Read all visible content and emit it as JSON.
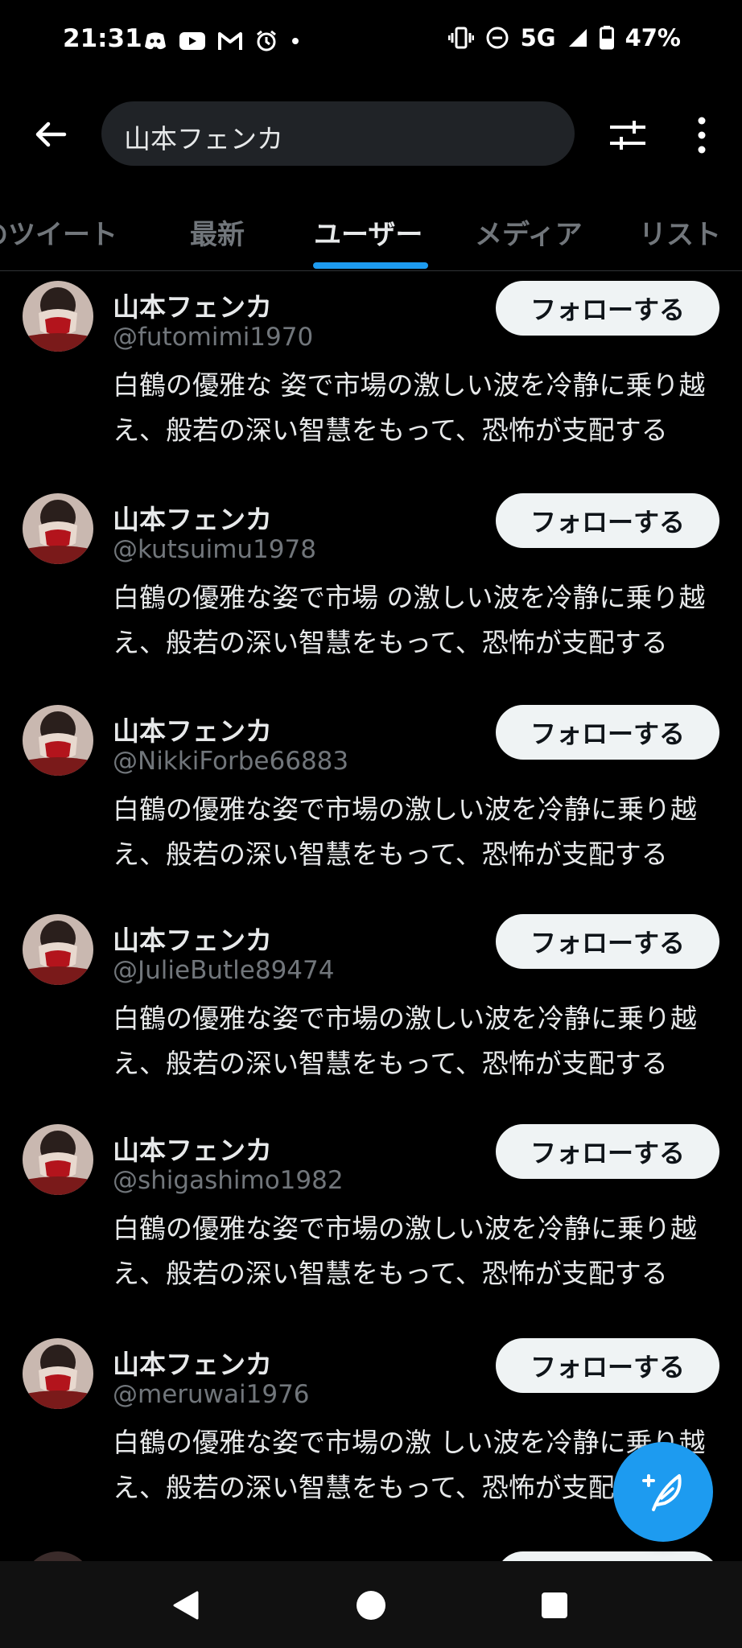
{
  "status_bar": {
    "time": "21:31",
    "network": "5G",
    "battery": "47%",
    "icons_left": [
      "discord-icon",
      "youtube-icon",
      "gmail-icon",
      "alarm-icon",
      "dot-icon"
    ],
    "icons_right": [
      "vibrate-icon",
      "do-not-disturb-icon",
      "signal-icon",
      "battery-icon"
    ]
  },
  "header": {
    "search_query": "山本フェンカ",
    "icons": [
      "back-arrow-icon",
      "filter-sliders-icon",
      "more-vertical-icon"
    ]
  },
  "tabs": [
    {
      "label": "のツイート",
      "active": false
    },
    {
      "label": "最新",
      "active": false
    },
    {
      "label": "ユーザー",
      "active": true
    },
    {
      "label": "メディア",
      "active": false
    },
    {
      "label": "リスト",
      "active": false
    }
  ],
  "users": [
    {
      "name": "山本フェンカ",
      "handle": "@futomimi1970",
      "bio": "白鶴の優雅な 姿で市場の激しい波を冷静に乗り越え、般若の深い智慧をもって、恐怖が支配する",
      "follow_label": "フォローする"
    },
    {
      "name": "山本フェンカ",
      "handle": "@kutsuimu1978",
      "bio": "白鶴の優雅な姿で市場 の激しい波を冷静に乗り越え、般若の深い智慧をもって、恐怖が支配する",
      "follow_label": "フォローする"
    },
    {
      "name": "山本フェンカ",
      "handle": "@NikkiForbe66883",
      "bio": "白鶴の優雅な姿で市場の激しい波を冷静に乗り越え、般若の深い智慧をもって、恐怖が支配する",
      "follow_label": "フォローする"
    },
    {
      "name": "山本フェンカ",
      "handle": "@JulieButle89474",
      "bio": "白鶴の優雅な姿で市場の激しい波を冷静に乗り越え、般若の深い智慧をもって、恐怖が支配する",
      "follow_label": "フォローする"
    },
    {
      "name": "山本フェンカ",
      "handle": "@shigashimo1982",
      "bio": "白鶴の優雅な姿で市場の激しい波を冷静に乗り越え、般若の深い智慧をもって、恐怖が支配する",
      "follow_label": "フォローする"
    },
    {
      "name": "山本フェンカ",
      "handle": "@meruwai1976",
      "bio": "白鶴の優雅な姿で市場の激 しい波を冷静に乗り越え、般若の深い智慧をもって、恐怖が支配する",
      "follow_label": "フォローする"
    }
  ],
  "fab": {
    "icon": "compose-tweet-icon"
  },
  "nav_bar": {
    "icons": [
      "nav-back-icon",
      "nav-home-icon",
      "nav-recents-icon"
    ]
  },
  "colors": {
    "accent": "#1d9bf0",
    "background": "#000000",
    "secondary_text": "#71767b",
    "button_bg": "#eff3f4"
  }
}
